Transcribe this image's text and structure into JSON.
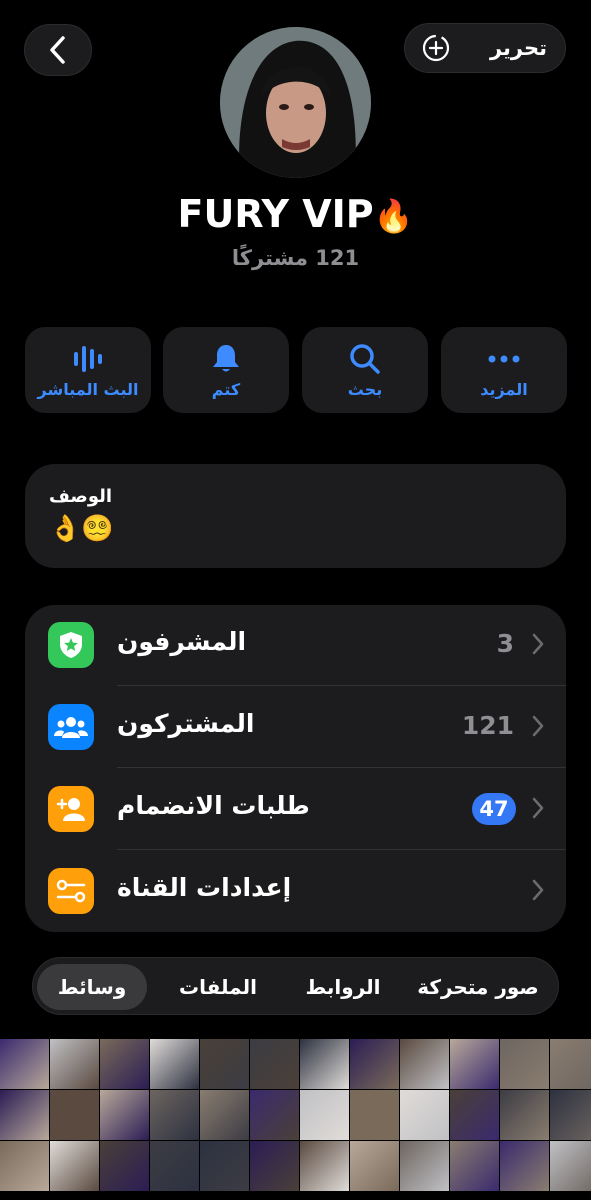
{
  "header": {
    "back_icon": "chevron-left-icon",
    "edit_label": "تحرير",
    "add_icon": "add-circle-icon"
  },
  "profile": {
    "name": "FURY VIP",
    "flame": "🔥",
    "subscribers_text": "121 مشتركًا"
  },
  "actions": [
    {
      "label": "المزيد",
      "icon": "more-icon"
    },
    {
      "label": "بحث",
      "icon": "search-icon"
    },
    {
      "label": "كتم",
      "icon": "bell-icon"
    },
    {
      "label": "البث المباشر",
      "icon": "live-stream-icon"
    }
  ],
  "description": {
    "title": "الوصف",
    "emoji": "👌😵‍💫"
  },
  "list": [
    {
      "label": "المشرفون",
      "value": "3",
      "icon": "shield-star-icon",
      "color": "#34c759"
    },
    {
      "label": "المشتركون",
      "value": "121",
      "icon": "people-icon",
      "color": "#0a84ff"
    },
    {
      "label": "طلبات الانضمام",
      "badge": "47",
      "icon": "add-person-icon",
      "color": "#ff9f0a"
    },
    {
      "label": "إعدادات القناة",
      "value": "",
      "icon": "settings-toggle-icon",
      "color": "#ff9f0a"
    }
  ],
  "tabs": [
    {
      "label": "صور متحركة",
      "active": false
    },
    {
      "label": "الروابط",
      "active": false
    },
    {
      "label": "الملفات",
      "active": false
    },
    {
      "label": "وسائط",
      "active": true
    }
  ],
  "colors": {
    "accent": "#3d8bff",
    "card": "#1c1c1e",
    "background": "#000000"
  }
}
